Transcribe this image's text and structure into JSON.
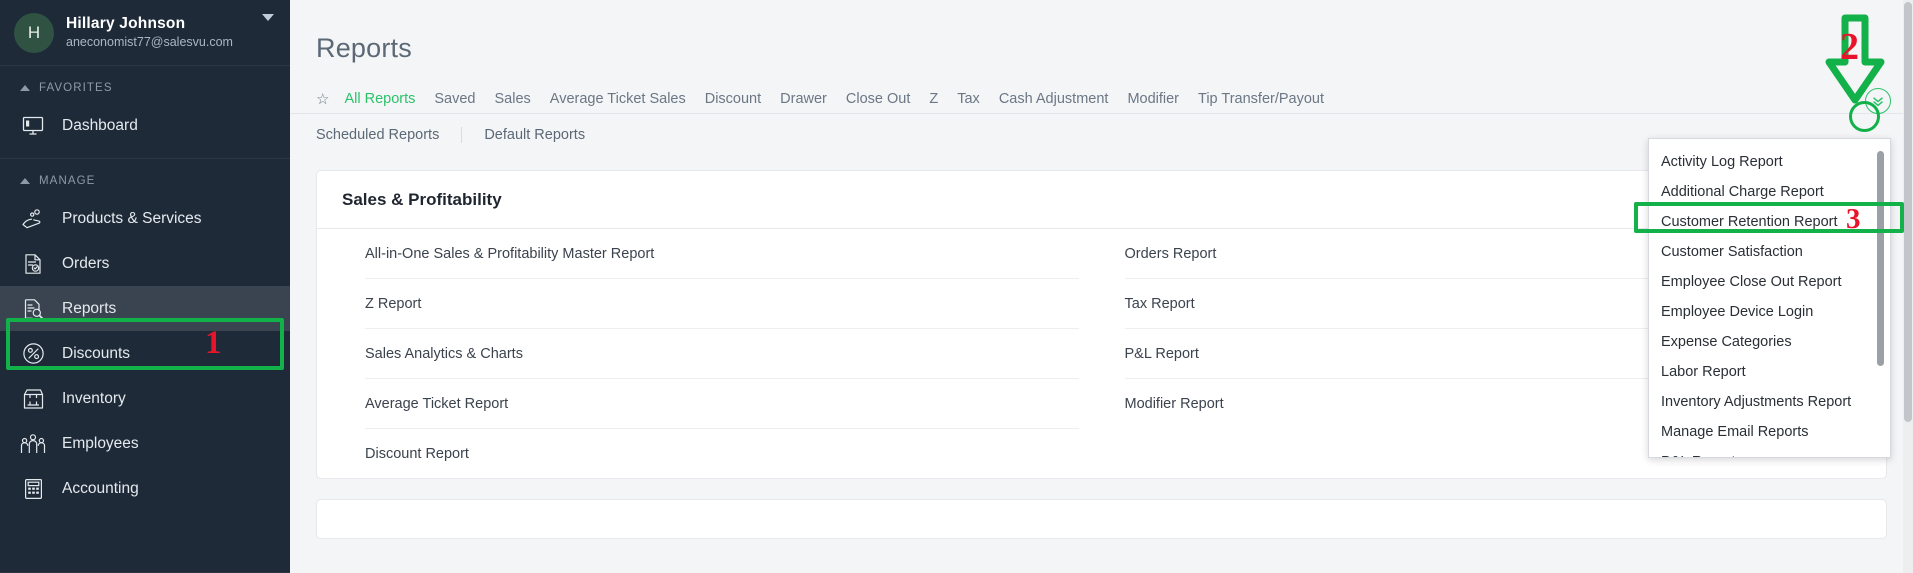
{
  "sidebar": {
    "user": {
      "initial": "H",
      "name": "Hillary Johnson",
      "email": "aneconomist77@salesvu.com"
    },
    "groups": [
      {
        "title": "FAVORITES",
        "items": [
          {
            "label": "Dashboard",
            "icon": "monitor-icon",
            "active": false
          }
        ]
      },
      {
        "title": "MANAGE",
        "items": [
          {
            "label": "Products & Services",
            "icon": "products-icon",
            "active": false
          },
          {
            "label": "Orders",
            "icon": "orders-icon",
            "active": false
          },
          {
            "label": "Reports",
            "icon": "reports-icon",
            "active": true
          },
          {
            "label": "Discounts",
            "icon": "percent-icon",
            "active": false
          },
          {
            "label": "Inventory",
            "icon": "inventory-icon",
            "active": false
          },
          {
            "label": "Employees",
            "icon": "employees-icon",
            "active": false
          },
          {
            "label": "Accounting",
            "icon": "calculator-icon",
            "active": false
          }
        ]
      }
    ]
  },
  "main": {
    "title": "Reports",
    "tabs": [
      {
        "label": "All Reports",
        "active": true
      },
      {
        "label": "Saved",
        "active": false
      },
      {
        "label": "Sales",
        "active": false
      },
      {
        "label": "Average Ticket Sales",
        "active": false
      },
      {
        "label": "Discount",
        "active": false
      },
      {
        "label": "Drawer",
        "active": false
      },
      {
        "label": "Close Out",
        "active": false
      },
      {
        "label": "Z",
        "active": false
      },
      {
        "label": "Tax",
        "active": false
      },
      {
        "label": "Cash Adjustment",
        "active": false
      },
      {
        "label": "Modifier",
        "active": false
      },
      {
        "label": "Tip Transfer/Payout",
        "active": false
      }
    ],
    "subtabs": [
      {
        "label": "Scheduled Reports"
      },
      {
        "label": "Default Reports"
      }
    ],
    "card": {
      "heading": "Sales & Profitability",
      "left_column": [
        "All-in-One Sales & Profitability Master Report",
        "Z Report",
        "Sales Analytics & Charts",
        "Average Ticket Report",
        "Discount Report"
      ],
      "right_column": [
        "Orders Report",
        "Tax Report",
        "P&L Report",
        "Modifier Report"
      ]
    }
  },
  "dropdown": {
    "items": [
      {
        "label": "Activity Log Report",
        "highlighted": false
      },
      {
        "label": "Additional Charge Report",
        "highlighted": false
      },
      {
        "label": "Customer Retention Report",
        "highlighted": true
      },
      {
        "label": "Customer Satisfaction",
        "highlighted": false
      },
      {
        "label": "Employee Close Out Report",
        "highlighted": false
      },
      {
        "label": "Employee Device Login",
        "highlighted": false
      },
      {
        "label": "Expense Categories",
        "highlighted": false
      },
      {
        "label": "Labor Report",
        "highlighted": false
      },
      {
        "label": "Inventory Adjustments Report",
        "highlighted": false
      },
      {
        "label": "Manage Email Reports",
        "highlighted": false
      },
      {
        "label": "P&L Report",
        "highlighted": false
      }
    ]
  },
  "annotations": {
    "step1": "1",
    "step2": "2",
    "step3": "3"
  },
  "colors": {
    "accent_green": "#2cc26a",
    "annotation_green": "#12b14a",
    "annotation_red": "#e8142a",
    "sidebar_bg": "#1e2a38",
    "page_bg": "#f4f5f7"
  },
  "icons": {
    "star": "☆",
    "chevron_double_down": "⌄⌄"
  }
}
